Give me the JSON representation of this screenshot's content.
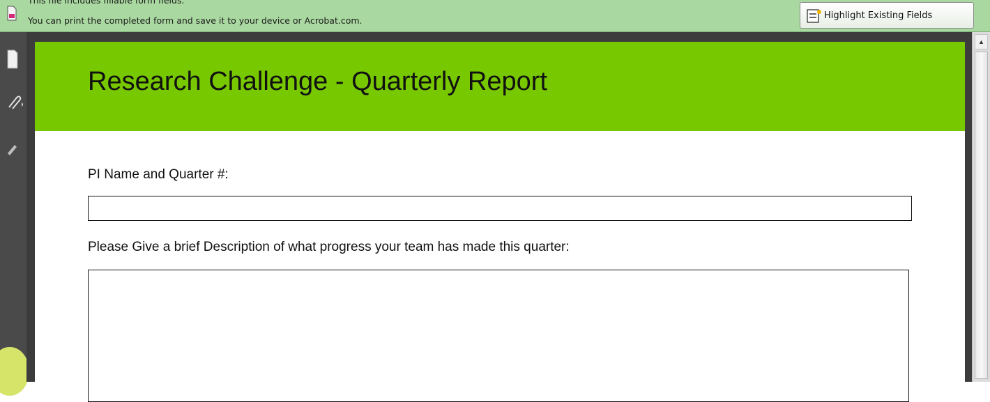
{
  "notification": {
    "line1": "This file includes fillable form fields.",
    "line2": "You can print the completed form and save it to your device or Acrobat.com.",
    "highlight_button": "Highlight Existing Fields",
    "icon": "pdf-document-icon"
  },
  "toolbar": {
    "icons": [
      "page-thumbnail-icon",
      "attachment-icon",
      "signature-icon"
    ]
  },
  "form": {
    "title": "Research Challenge - Quarterly Report",
    "fields": [
      {
        "label": "PI Name and Quarter #:",
        "value": ""
      },
      {
        "label": "Please Give a brief Description of what progress your team has made this quarter:",
        "value": ""
      }
    ]
  },
  "colors": {
    "notification_bar": "#a9d8a0",
    "header_green": "#78c800",
    "frame": "#3c3c3c"
  }
}
